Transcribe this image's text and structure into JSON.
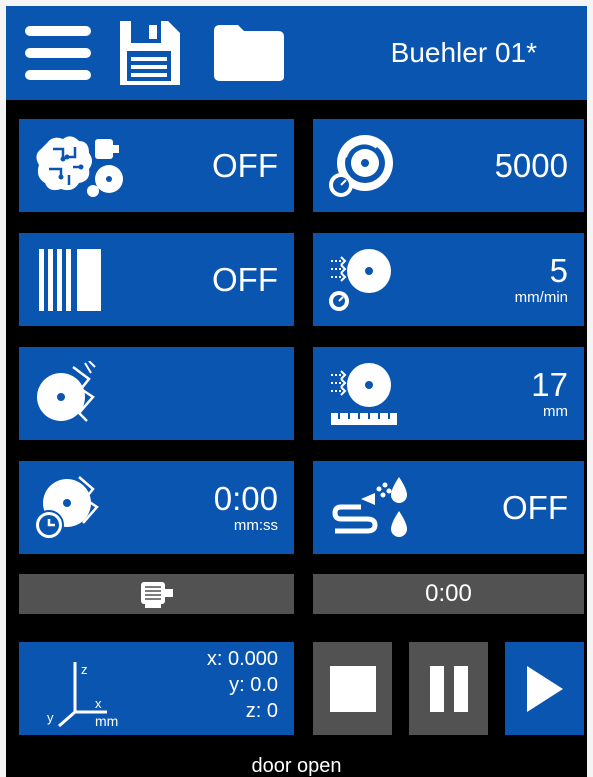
{
  "window": {
    "title": "Buehler 01*"
  },
  "topbar": {
    "menu_icon": "hamburger-menu-icon",
    "save_icon": "floppy-disk-save-icon",
    "open_icon": "folder-open-icon"
  },
  "tiles": {
    "smart_mode": {
      "value": "OFF"
    },
    "speed": {
      "value": "5000"
    },
    "barcode": {
      "value": "OFF"
    },
    "feed_rate": {
      "value": "5",
      "unit": "mm/min"
    },
    "cut_mode": {
      "value": ""
    },
    "cut_depth": {
      "value": "17",
      "unit": "mm"
    },
    "cut_time": {
      "value": "0:00",
      "unit": "mm:ss"
    },
    "coolant": {
      "value": "OFF"
    }
  },
  "bars": {
    "timer": "0:00"
  },
  "position": {
    "x": "x: 0.000",
    "y": "y: 0.0",
    "z": "z: 0",
    "unit": "mm",
    "axis_z": "z",
    "axis_x": "x",
    "axis_y": "y"
  },
  "controls": {
    "stop_icon": "stop-icon",
    "pause_icon": "pause-icon",
    "play_icon": "play-icon"
  },
  "status": {
    "text": "door open"
  },
  "colors": {
    "tile": "#0a55b0",
    "bar": "#525252",
    "background": "#000000"
  }
}
